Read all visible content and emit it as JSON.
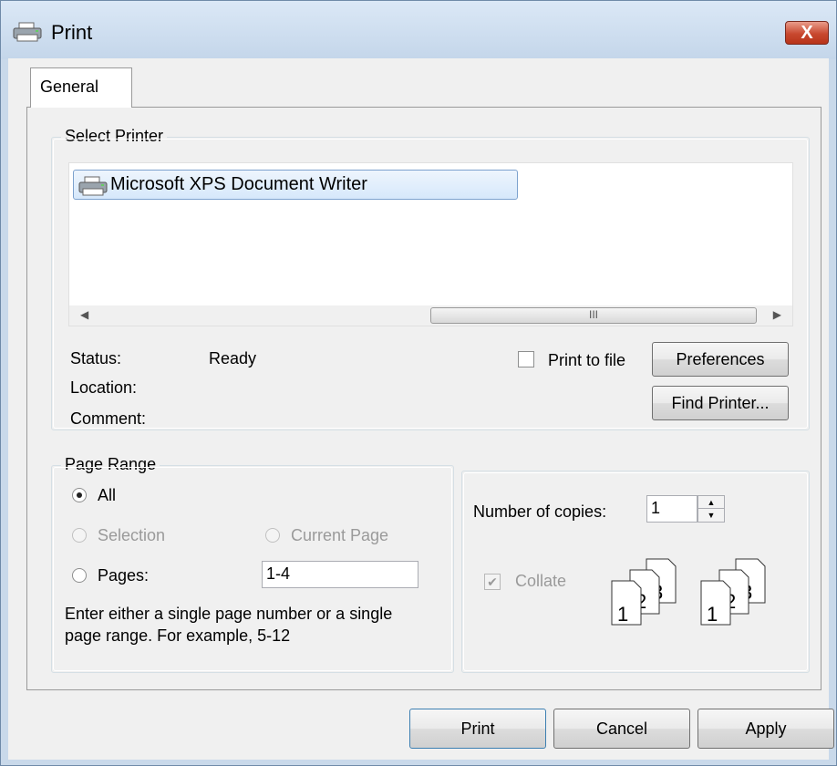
{
  "window": {
    "title": "Print",
    "close_label": "X"
  },
  "tabs": [
    {
      "label": "General"
    }
  ],
  "select_printer": {
    "title": "Select Printer",
    "printers": [
      {
        "name": "Microsoft XPS Document Writer"
      }
    ],
    "scrollbar_thumb_grip": "III",
    "status_label": "Status:",
    "status_value": "Ready",
    "location_label": "Location:",
    "comment_label": "Comment:",
    "print_to_file_label": "Print to file",
    "print_to_file_checked": false,
    "preferences_label": "Preferences",
    "find_printer_label": "Find Printer..."
  },
  "page_range": {
    "title": "Page Range",
    "selected": "All",
    "all_label": "All",
    "selection_label": "Selection",
    "current_page_label": "Current Page",
    "pages_label": "Pages:",
    "pages_value": "1-4",
    "hint_line1": "Enter either a single page number or a single",
    "hint_line2": "page range.  For example, 5-12"
  },
  "copies": {
    "label": "Number of copies:",
    "value": "1",
    "collate_label": "Collate",
    "collate_checked": true,
    "collate_digits": [
      "1",
      "2",
      "3"
    ]
  },
  "buttons": {
    "print": "Print",
    "cancel": "Cancel",
    "apply": "Apply"
  }
}
